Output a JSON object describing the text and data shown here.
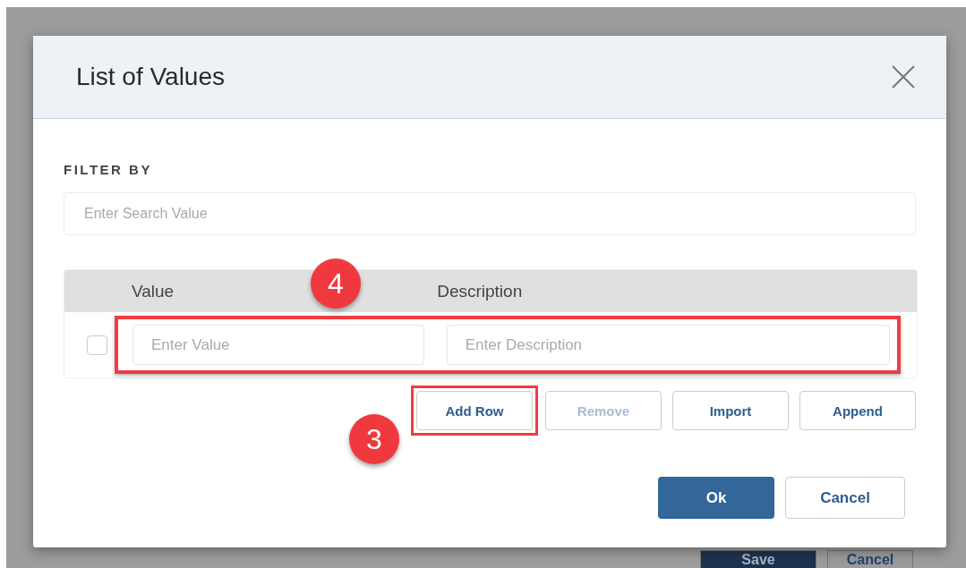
{
  "background_buttons": [
    {
      "label": "Save",
      "kind": "primary"
    },
    {
      "label": "Cancel",
      "kind": "secondary"
    }
  ],
  "dialog": {
    "title": "List of Values"
  },
  "filter": {
    "label": "FILTER BY",
    "placeholder": "Enter Search Value"
  },
  "table": {
    "columns": [
      "Value",
      "Description"
    ],
    "rows": [
      {
        "checked": false,
        "value_placeholder": "Enter Value",
        "description_placeholder": "Enter Description",
        "highlighted": true,
        "callout": "4"
      }
    ]
  },
  "row_buttons": [
    {
      "label": "Add Row",
      "disabled": false,
      "highlighted": true,
      "callout": "3"
    },
    {
      "label": "Remove",
      "disabled": true,
      "highlighted": false
    },
    {
      "label": "Import",
      "disabled": false,
      "highlighted": false
    },
    {
      "label": "Append",
      "disabled": false,
      "highlighted": false
    }
  ],
  "footer_buttons": [
    {
      "label": "Ok",
      "kind": "primary"
    },
    {
      "label": "Cancel",
      "kind": "secondary"
    }
  ]
}
